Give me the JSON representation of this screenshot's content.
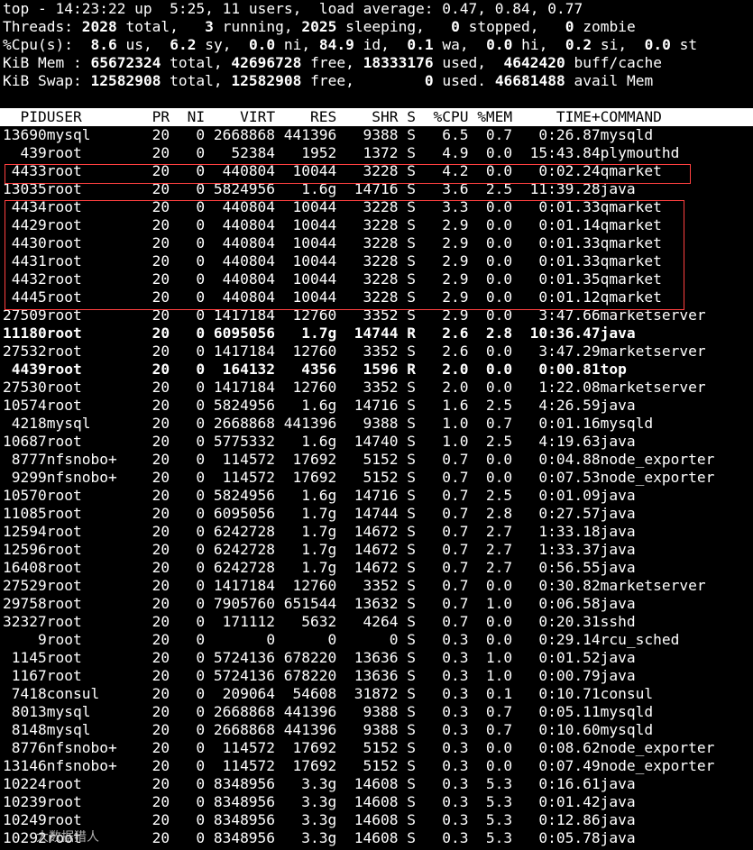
{
  "summary": {
    "uptime": "top - 14:23:22 up  5:25, 11 users,  load average: 0.47, 0.84, 0.77",
    "threads": {
      "label": "Threads:",
      "total": "2028",
      "total_l": " total,   ",
      "running": "3",
      "running_l": " running, ",
      "sleeping": "2025",
      "sleeping_l": " sleeping,   ",
      "stopped": "0",
      "stopped_l": " stopped,   ",
      "zombie": "0",
      "zombie_l": " zombie"
    },
    "cpu": {
      "label": "%Cpu(s):  ",
      "us": "8.6",
      "us_l": " us,  ",
      "sy": "6.2",
      "sy_l": " sy,  ",
      "ni": "0.0",
      "ni_l": " ni, ",
      "id": "84.9",
      "id_l": " id,  ",
      "wa": "0.1",
      "wa_l": " wa,  ",
      "hi": "0.0",
      "hi_l": " hi,  ",
      "si": "0.2",
      "si_l": " si,  ",
      "st": "0.0",
      "st_l": " st"
    },
    "mem": {
      "label": "KiB Mem : ",
      "total": "65672324",
      "total_l": " total, ",
      "free": "42696728",
      "free_l": " free, ",
      "used": "18333176",
      "used_l": " used,  ",
      "buff": "4642420",
      "buff_l": " buff/cache"
    },
    "swap": {
      "label": "KiB Swap: ",
      "total": "12582908",
      "total_l": " total, ",
      "free": "12582908",
      "free_l": " free,        ",
      "used": "0",
      "used_l": " used. ",
      "avail": "46681488",
      "avail_l": " avail Mem"
    }
  },
  "table": {
    "header": [
      "PID",
      "USER",
      "PR",
      "NI",
      "VIRT",
      "RES",
      "SHR",
      "S",
      "%CPU",
      "%MEM",
      "TIME+",
      "COMMAND"
    ],
    "rows": [
      [
        "13690",
        "mysql",
        "20",
        "0",
        "2668868",
        "441396",
        "9388",
        "S",
        "6.5",
        "0.7",
        "0:26.87",
        "mysqld"
      ],
      [
        "439",
        "root",
        "20",
        "0",
        "52384",
        "1952",
        "1372",
        "S",
        "4.9",
        "0.0",
        "15:43.84",
        "plymouthd"
      ],
      [
        "4433",
        "root",
        "20",
        "0",
        "440804",
        "10044",
        "3228",
        "S",
        "4.2",
        "0.0",
        "0:02.24",
        "qmarket"
      ],
      [
        "13035",
        "root",
        "20",
        "0",
        "5824956",
        "1.6g",
        "14716",
        "S",
        "3.6",
        "2.5",
        "11:39.28",
        "java"
      ],
      [
        "4434",
        "root",
        "20",
        "0",
        "440804",
        "10044",
        "3228",
        "S",
        "3.3",
        "0.0",
        "0:01.33",
        "qmarket"
      ],
      [
        "4429",
        "root",
        "20",
        "0",
        "440804",
        "10044",
        "3228",
        "S",
        "2.9",
        "0.0",
        "0:01.14",
        "qmarket"
      ],
      [
        "4430",
        "root",
        "20",
        "0",
        "440804",
        "10044",
        "3228",
        "S",
        "2.9",
        "0.0",
        "0:01.33",
        "qmarket"
      ],
      [
        "4431",
        "root",
        "20",
        "0",
        "440804",
        "10044",
        "3228",
        "S",
        "2.9",
        "0.0",
        "0:01.33",
        "qmarket"
      ],
      [
        "4432",
        "root",
        "20",
        "0",
        "440804",
        "10044",
        "3228",
        "S",
        "2.9",
        "0.0",
        "0:01.35",
        "qmarket"
      ],
      [
        "4445",
        "root",
        "20",
        "0",
        "440804",
        "10044",
        "3228",
        "S",
        "2.9",
        "0.0",
        "0:01.12",
        "qmarket"
      ],
      [
        "27509",
        "root",
        "20",
        "0",
        "1417184",
        "12760",
        "3352",
        "S",
        "2.9",
        "0.0",
        "3:47.66",
        "marketserver"
      ],
      [
        "11180",
        "root",
        "20",
        "0",
        "6095056",
        "1.7g",
        "14744",
        "R",
        "2.6",
        "2.8",
        "10:36.47",
        "java"
      ],
      [
        "27532",
        "root",
        "20",
        "0",
        "1417184",
        "12760",
        "3352",
        "S",
        "2.6",
        "0.0",
        "3:47.29",
        "marketserver"
      ],
      [
        "4439",
        "root",
        "20",
        "0",
        "164132",
        "4356",
        "1596",
        "R",
        "2.0",
        "0.0",
        "0:00.81",
        "top"
      ],
      [
        "27530",
        "root",
        "20",
        "0",
        "1417184",
        "12760",
        "3352",
        "S",
        "2.0",
        "0.0",
        "1:22.08",
        "marketserver"
      ],
      [
        "10574",
        "root",
        "20",
        "0",
        "5824956",
        "1.6g",
        "14716",
        "S",
        "1.6",
        "2.5",
        "4:26.59",
        "java"
      ],
      [
        "4218",
        "mysql",
        "20",
        "0",
        "2668868",
        "441396",
        "9388",
        "S",
        "1.0",
        "0.7",
        "0:01.16",
        "mysqld"
      ],
      [
        "10687",
        "root",
        "20",
        "0",
        "5775332",
        "1.6g",
        "14740",
        "S",
        "1.0",
        "2.5",
        "4:19.63",
        "java"
      ],
      [
        "8777",
        "nfsnobo+",
        "20",
        "0",
        "114572",
        "17692",
        "5152",
        "S",
        "0.7",
        "0.0",
        "0:04.88",
        "node_exporter"
      ],
      [
        "9299",
        "nfsnobo+",
        "20",
        "0",
        "114572",
        "17692",
        "5152",
        "S",
        "0.7",
        "0.0",
        "0:07.53",
        "node_exporter"
      ],
      [
        "10570",
        "root",
        "20",
        "0",
        "5824956",
        "1.6g",
        "14716",
        "S",
        "0.7",
        "2.5",
        "0:01.09",
        "java"
      ],
      [
        "11085",
        "root",
        "20",
        "0",
        "6095056",
        "1.7g",
        "14744",
        "S",
        "0.7",
        "2.8",
        "0:27.57",
        "java"
      ],
      [
        "12594",
        "root",
        "20",
        "0",
        "6242728",
        "1.7g",
        "14672",
        "S",
        "0.7",
        "2.7",
        "1:33.18",
        "java"
      ],
      [
        "12596",
        "root",
        "20",
        "0",
        "6242728",
        "1.7g",
        "14672",
        "S",
        "0.7",
        "2.7",
        "1:33.37",
        "java"
      ],
      [
        "16408",
        "root",
        "20",
        "0",
        "6242728",
        "1.7g",
        "14672",
        "S",
        "0.7",
        "2.7",
        "0:56.55",
        "java"
      ],
      [
        "27529",
        "root",
        "20",
        "0",
        "1417184",
        "12760",
        "3352",
        "S",
        "0.7",
        "0.0",
        "0:30.82",
        "marketserver"
      ],
      [
        "29758",
        "root",
        "20",
        "0",
        "7905760",
        "651544",
        "13632",
        "S",
        "0.7",
        "1.0",
        "0:06.58",
        "java"
      ],
      [
        "32327",
        "root",
        "20",
        "0",
        "171112",
        "5632",
        "4264",
        "S",
        "0.7",
        "0.0",
        "0:20.31",
        "sshd"
      ],
      [
        "9",
        "root",
        "20",
        "0",
        "0",
        "0",
        "0",
        "S",
        "0.3",
        "0.0",
        "0:29.14",
        "rcu_sched"
      ],
      [
        "1145",
        "root",
        "20",
        "0",
        "5724136",
        "678220",
        "13636",
        "S",
        "0.3",
        "1.0",
        "0:01.52",
        "java"
      ],
      [
        "1167",
        "root",
        "20",
        "0",
        "5724136",
        "678220",
        "13636",
        "S",
        "0.3",
        "1.0",
        "0:00.79",
        "java"
      ],
      [
        "7418",
        "consul",
        "20",
        "0",
        "209064",
        "54608",
        "31872",
        "S",
        "0.3",
        "0.1",
        "0:10.71",
        "consul"
      ],
      [
        "8013",
        "mysql",
        "20",
        "0",
        "2668868",
        "441396",
        "9388",
        "S",
        "0.3",
        "0.7",
        "0:05.11",
        "mysqld"
      ],
      [
        "8148",
        "mysql",
        "20",
        "0",
        "2668868",
        "441396",
        "9388",
        "S",
        "0.3",
        "0.7",
        "0:10.60",
        "mysqld"
      ],
      [
        "8776",
        "nfsnobo+",
        "20",
        "0",
        "114572",
        "17692",
        "5152",
        "S",
        "0.3",
        "0.0",
        "0:08.62",
        "node_exporter"
      ],
      [
        "13146",
        "nfsnobo+",
        "20",
        "0",
        "114572",
        "17692",
        "5152",
        "S",
        "0.3",
        "0.0",
        "0:07.49",
        "node_exporter"
      ],
      [
        "10224",
        "root",
        "20",
        "0",
        "8348956",
        "3.3g",
        "14608",
        "S",
        "0.3",
        "5.3",
        "0:16.61",
        "java"
      ],
      [
        "10239",
        "root",
        "20",
        "0",
        "8348956",
        "3.3g",
        "14608",
        "S",
        "0.3",
        "5.3",
        "0:01.42",
        "java"
      ],
      [
        "10249",
        "root",
        "20",
        "0",
        "8348956",
        "3.3g",
        "14608",
        "S",
        "0.3",
        "5.3",
        "0:12.86",
        "java"
      ],
      [
        "10292",
        "root",
        "20",
        "0",
        "8348956",
        "3.3g",
        "14608",
        "S",
        "0.3",
        "5.3",
        "0:05.78",
        "java"
      ]
    ],
    "bold_pids": [
      "11180",
      "4439"
    ]
  },
  "watermark": "大数据猎人",
  "colors": {
    "background": "#000000",
    "text": "#ffffff",
    "header_bg": "#ffffff",
    "header_fg": "#000000",
    "highlight": "#ff4040"
  }
}
